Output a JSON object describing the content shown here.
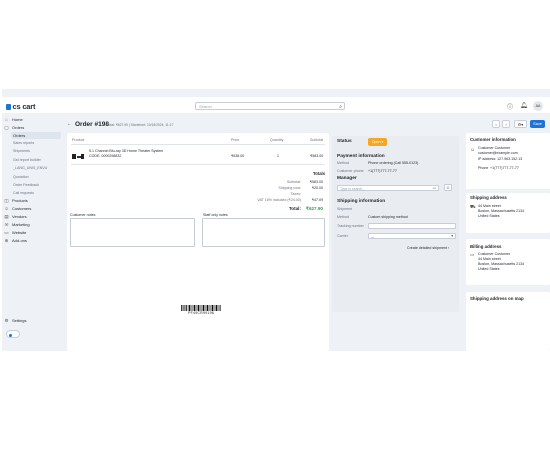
{
  "topbar": {
    "logo": "cs cart",
    "search_placeholder": "Search",
    "avatar_initials": "AA"
  },
  "sidebar": {
    "items": [
      {
        "label": "Home",
        "icon": "home-icon"
      },
      {
        "label": "Orders",
        "icon": "orders-icon"
      },
      {
        "label": "Orders",
        "active": true
      },
      {
        "label": "Sales reports",
        "sub": true
      },
      {
        "label": "Shipments",
        "sub": true
      },
      {
        "label": "Gst report builder",
        "sub": true
      },
      {
        "label": "_LANG_UNIS_ENVU",
        "sub": true
      },
      {
        "label": "Quotation",
        "sub": true
      },
      {
        "label": "Order Feedback",
        "sub": true
      },
      {
        "label": "Call requests",
        "sub": true
      },
      {
        "label": "Products",
        "icon": "products-icon"
      },
      {
        "label": "Customers",
        "icon": "customers-icon"
      },
      {
        "label": "Vendors",
        "icon": "vendors-icon"
      },
      {
        "label": "Marketing",
        "icon": "marketing-icon"
      },
      {
        "label": "Website",
        "icon": "website-icon"
      },
      {
        "label": "Add-ons",
        "icon": "addons-icon"
      }
    ],
    "settings": "Settings"
  },
  "header": {
    "title": "Order #198",
    "subtitle": "Total: ₹627.90 | Storefront: 10/15/2024, 11:17",
    "save_label": "Save"
  },
  "order": {
    "columns": [
      "Product",
      "Price",
      "Quantity",
      "Subtotal"
    ],
    "product": {
      "name": "5.1 Channel Blu-ray 3D Home Theater System",
      "code": "CODE: 0000298832",
      "price": "₹538.00",
      "quantity": "1",
      "subtotal": "₹583.00"
    },
    "totals_heading": "Totals",
    "totals": [
      {
        "label": "Subtotal:",
        "value": "₹583.00"
      },
      {
        "label": "Shipping cost:",
        "value": "₹20.00"
      },
      {
        "label": "Taxes:",
        "value": ""
      },
      {
        "label": "VAT 16% included (₹24.00)",
        "value": "₹47.09"
      }
    ],
    "total_label": "Total:",
    "total_value": "₹627.90",
    "customer_notes": "Customer notes",
    "staff_notes": "Staff only notes",
    "barcode_text": "PF49CR99198"
  },
  "status_panel": {
    "status_label": "Status",
    "status_value": "Open",
    "payment_heading": "Payment information",
    "method_label": "Method",
    "method_value": "Phone ordering (Call 555-0123)",
    "phone_label": "Customer phone",
    "phone_value": "+1(777)777-77-77",
    "manager_heading": "Manager",
    "manager_placeholder": "Type to search...",
    "shipping_heading": "Shipping information",
    "shipping_method_label": "Method",
    "shipping_method_value": "Custom shipping method",
    "tracking_label": "Tracking number",
    "carrier_label": "Carrier",
    "carrier_value": "---",
    "detailed_link": "Create detailed shipment"
  },
  "customer": {
    "heading": "Customer information",
    "name": "Customer Customer",
    "email": "customer@example.com",
    "ip": "IP address: 127.963.152.13",
    "phone_label": "Phone",
    "phone": "+1(777)777-77-77"
  },
  "shipping_address": {
    "heading": "Shipping address",
    "lines": [
      "44 Main street",
      "Boston, Massachusetts 2134",
      "United States"
    ]
  },
  "billing_address": {
    "heading": "Billing address",
    "name": "Customer Customer",
    "lines": [
      "44 Main street",
      "Boston, Massachusetts 2134",
      "United States"
    ]
  },
  "map": {
    "heading": "Shipping address on map"
  },
  "colors": {
    "accent": "#1e73d8",
    "status": "#f5a623",
    "total_green": "#2e9e4f"
  }
}
